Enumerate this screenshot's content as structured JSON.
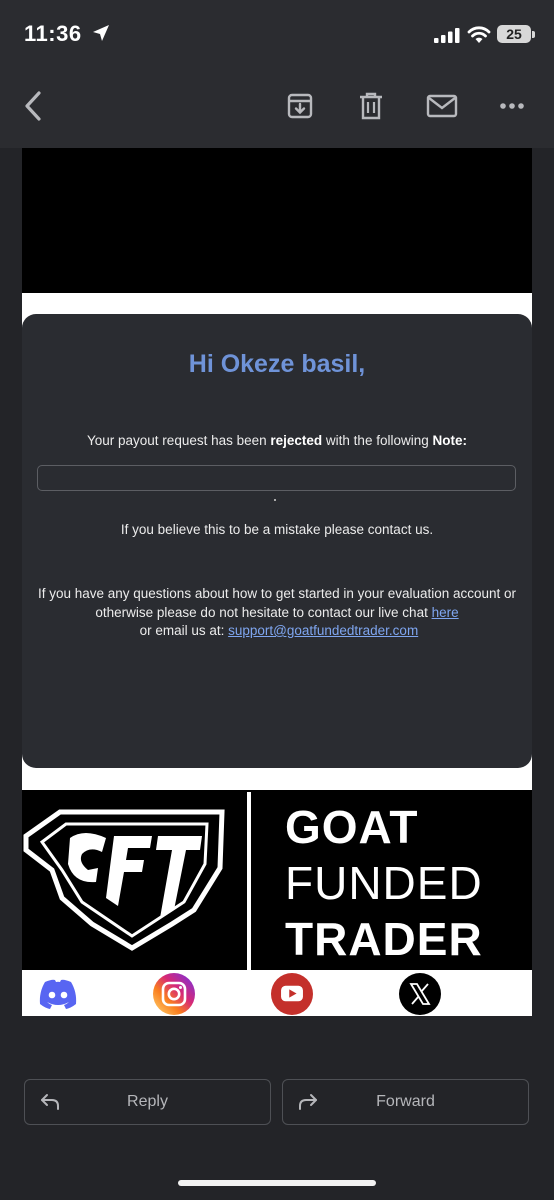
{
  "status_bar": {
    "time": "11:36",
    "battery": "25",
    "icons": [
      "location-arrow-icon",
      "signal-icon",
      "wifi-icon",
      "battery-icon"
    ]
  },
  "toolbar": {
    "icons": [
      "back-icon",
      "archive-icon",
      "trash-icon",
      "mail-icon",
      "more-icon"
    ]
  },
  "email": {
    "greeting": "Hi Okeze basil,",
    "message_prefix": "Your payout request has been ",
    "message_status": "rejected",
    "message_mid": " with the following ",
    "message_note_label": "Note:",
    "note_value": "",
    "mistake_text": "If you believe this to be a mistake please contact us.",
    "questions_text": "If you have any questions about how to get started in your evaluation account or otherwise please do not hesitate to contact our live chat ",
    "here_link": "here",
    "or_text": " or email us at: ",
    "email_link": "support@goatfundedtrader.com",
    "brand_line1": "GOAT",
    "brand_line2": "FUNDED",
    "brand_line3": "TRADER",
    "social_icons": [
      "discord-icon",
      "instagram-icon",
      "youtube-icon",
      "x-icon"
    ]
  },
  "actions": {
    "reply": "Reply",
    "forward": "Forward"
  }
}
